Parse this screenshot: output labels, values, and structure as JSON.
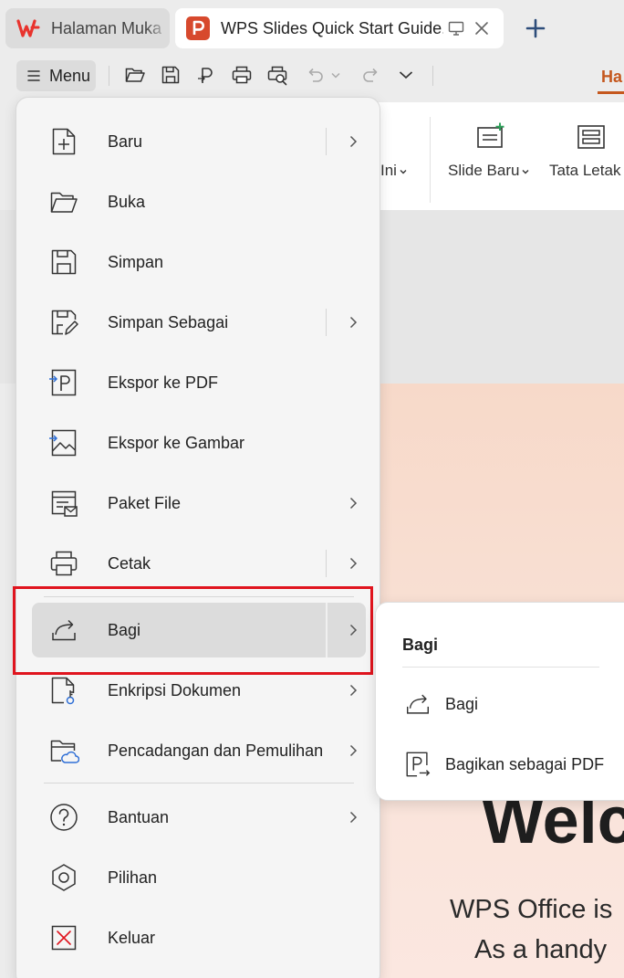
{
  "tabs": [
    {
      "title": "Halaman Muka",
      "icon": "wps-logo-icon",
      "color": "#e8332d"
    },
    {
      "title": "WPS Slides Quick Start Guide.pptx",
      "icon": "wps-slides-logo-icon",
      "color": "#d7492d"
    }
  ],
  "toolbar": {
    "menu_label": "Menu",
    "active_ribbon_tab": "Ha"
  },
  "ribbon": {
    "partial_label": "Ini",
    "new_slide_label": "Slide Baru",
    "layout_label": "Tata Letak"
  },
  "main_menu": {
    "items": [
      {
        "label": "Baru",
        "icon": "new-file-icon",
        "has_submenu": true
      },
      {
        "label": "Buka",
        "icon": "folder-open-icon",
        "has_submenu": false
      },
      {
        "label": "Simpan",
        "icon": "save-icon",
        "has_submenu": false
      },
      {
        "label": "Simpan Sebagai",
        "icon": "save-as-icon",
        "has_submenu": true
      },
      {
        "label": "Ekspor ke PDF",
        "icon": "export-pdf-icon",
        "has_submenu": false
      },
      {
        "label": "Ekspor ke Gambar",
        "icon": "export-image-icon",
        "has_submenu": false
      },
      {
        "label": "Paket File",
        "icon": "package-file-icon",
        "has_submenu": true
      },
      {
        "label": "Cetak",
        "icon": "print-icon",
        "has_submenu": true
      },
      {
        "label": "Bagi",
        "icon": "share-icon",
        "has_submenu": true,
        "active": true
      },
      {
        "label": "Enkripsi Dokumen",
        "icon": "encrypt-document-icon",
        "has_submenu": true
      },
      {
        "label": "Pencadangan dan Pemulihan",
        "icon": "backup-restore-icon",
        "has_submenu": true
      },
      {
        "label": "Bantuan",
        "icon": "help-icon",
        "has_submenu": true
      },
      {
        "label": "Pilihan",
        "icon": "options-icon",
        "has_submenu": false
      },
      {
        "label": "Keluar",
        "icon": "exit-icon",
        "has_submenu": false
      }
    ]
  },
  "submenu": {
    "title": "Bagi",
    "items": [
      {
        "label": "Bagi",
        "icon": "share-icon"
      },
      {
        "label": "Bagikan sebagai PDF",
        "icon": "share-pdf-icon"
      }
    ]
  },
  "slide": {
    "heading_partial": "Welc",
    "line1_partial": "WPS Office is",
    "line2_partial": "As a handy"
  },
  "colors": {
    "accent": "#c5581e",
    "highlight": "#e0141e",
    "slide_bg": "#f8dccd"
  }
}
